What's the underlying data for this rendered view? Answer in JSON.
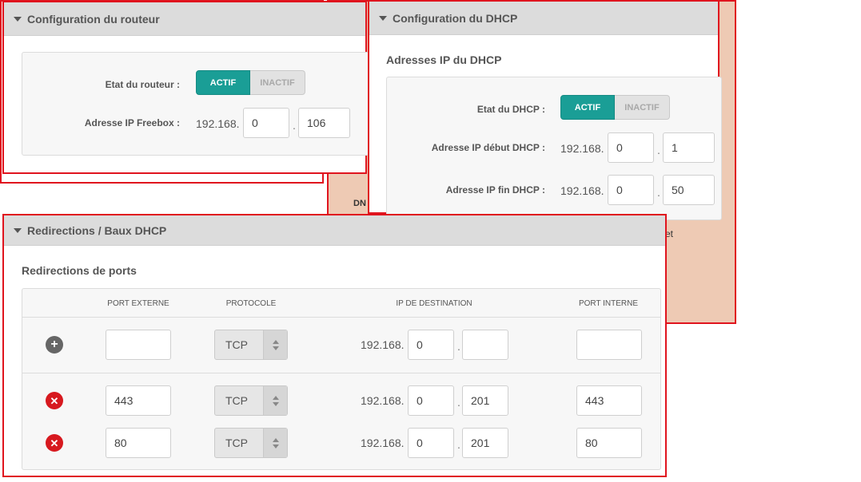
{
  "router": {
    "title": "Configuration du routeur",
    "state_label": "Etat du routeur :",
    "toggle_on": "ACTIF",
    "toggle_off": "INACTIF",
    "ip_label": "Adresse IP Freebox :",
    "ip_prefix": "192.168.",
    "ip_octet3": "0",
    "ip_octet4": "106"
  },
  "background_panel": {
    "text_dns": "DN",
    "text_et": "et"
  },
  "dhcp": {
    "title": "Configuration du DHCP",
    "section_title": "Adresses IP du DHCP",
    "state_label": "Etat du DHCP :",
    "toggle_on": "ACTIF",
    "toggle_off": "INACTIF",
    "start_label": "Adresse IP début DHCP :",
    "start_prefix": "192.168.",
    "start_octet3": "0",
    "start_octet4": "1",
    "end_label": "Adresse IP fin DHCP :",
    "end_prefix": "192.168.",
    "end_octet3": "0",
    "end_octet4": "50"
  },
  "redirections": {
    "title": "Redirections / Baux DHCP",
    "section_title": "Redirections de ports",
    "columns": [
      "PORT EXTERNE",
      "PROTOCOLE",
      "IP DE DESTINATION",
      "PORT INTERNE"
    ],
    "new_row": {
      "external_port": "",
      "protocol": "TCP",
      "ip_prefix": "192.168.",
      "ip_octet3": "0",
      "ip_octet4": "",
      "internal_port": ""
    },
    "rows": [
      {
        "external_port": "443",
        "protocol": "TCP",
        "ip_prefix": "192.168.",
        "ip_octet3": "0",
        "ip_octet4": "201",
        "internal_port": "443"
      },
      {
        "external_port": "80",
        "protocol": "TCP",
        "ip_prefix": "192.168.",
        "ip_octet3": "0",
        "ip_octet4": "201",
        "internal_port": "80"
      }
    ],
    "dot": "."
  },
  "colors": {
    "accent": "#1a9e96",
    "border_highlight": "#e0141e",
    "delete": "#d7191f",
    "background_panel": "#eecab4"
  }
}
